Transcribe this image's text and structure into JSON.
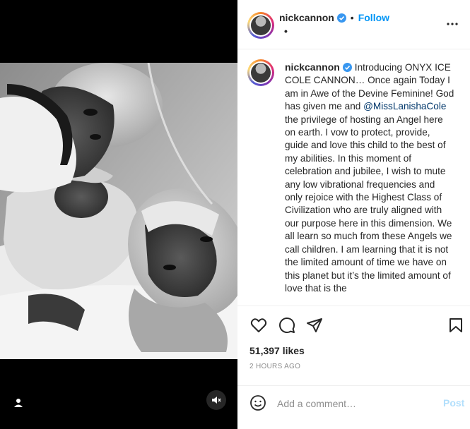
{
  "media": {
    "photo_icon": "black-and-white-newborn-photo",
    "tag_icon": "user-tag-icon",
    "mute_icon": "sound-off-icon"
  },
  "header": {
    "username": "nickcannon",
    "verified_icon": "verified-badge-icon",
    "dot": "•",
    "follow_label": "Follow",
    "subtitle": "•",
    "more_icon": "more-options-icon"
  },
  "caption": {
    "username": "nickcannon",
    "text_before": "Introducing ONYX ICE COLE CANNON… Once again Today I am in Awe of the Devine Feminine! God has given me and ",
    "mention": "@MissLanishaCole",
    "text_after": " the privilege of hosting an Angel here on earth. I vow to protect, provide, guide and love this child to the best of my abilities. In this moment of celebration and jubilee, I wish to mute any low vibrational frequencies and only rejoice with the Highest Class of Civilization who are truly aligned with our purpose here in this dimension. We all learn so much from these Angels we call children. I am learning that it is not the limited amount of time we have on this planet but it’s the limited amount of love that is the"
  },
  "actions": {
    "like_icon": "heart-icon",
    "comment_icon": "comment-icon",
    "share_icon": "share-icon",
    "save_icon": "bookmark-icon"
  },
  "likes": "51,397 likes",
  "timestamp": "2 HOURS AGO",
  "comment": {
    "placeholder": "Add a comment…",
    "post_label": "Post",
    "emoji_icon": "emoji-icon"
  },
  "colors": {
    "accent": "#0095f6",
    "post_disabled": "#b2dffc",
    "verified": "#3897f0"
  }
}
